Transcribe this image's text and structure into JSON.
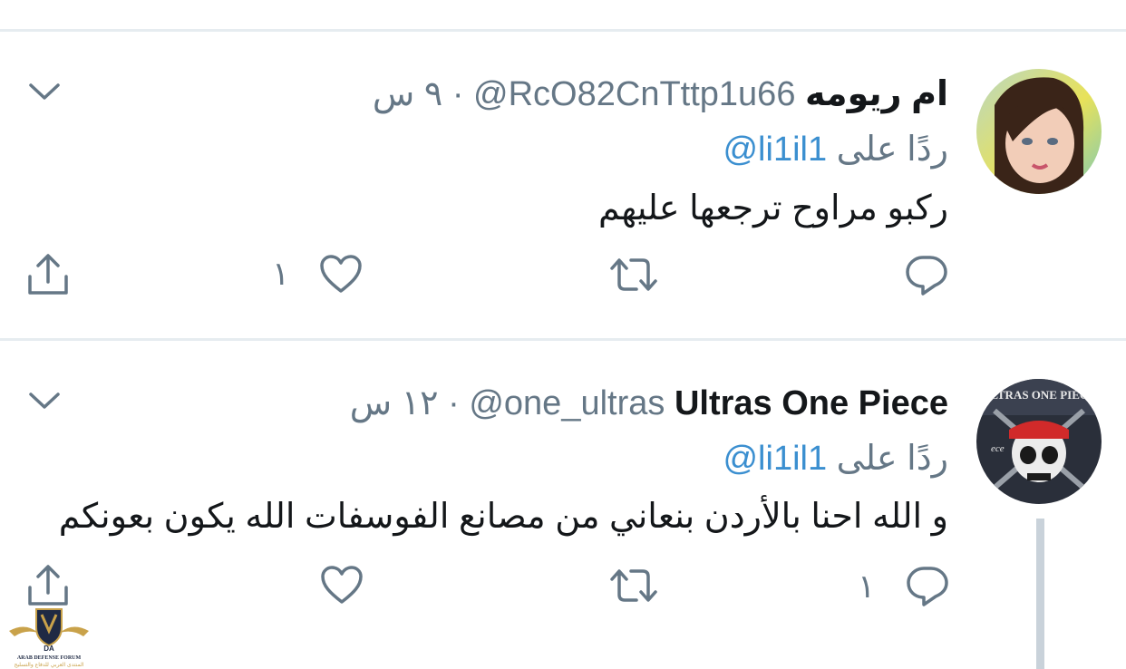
{
  "tweets": [
    {
      "name": "ام ريومه",
      "handle": "@RcO82CnTttp1u66",
      "separator": "·",
      "time": "٩ س",
      "replying_prefix": "ردًا على",
      "replying_to": "@li1il1",
      "text": "ركبو مراوح ترجعها عليهم",
      "reply_count": "",
      "like_count": "١",
      "avatar_icon": "avatar-photo-girl"
    },
    {
      "name": "Ultras One Piece",
      "handle": "@one_ultras",
      "separator": "·",
      "time": "١٢ س",
      "replying_prefix": "ردًا على",
      "replying_to": "@li1il1",
      "text": "و الله احنا بالأردن بنعاني من مصانع الفوسفات الله يكون بعونكم",
      "reply_count": "١",
      "like_count": "",
      "avatar_icon": "avatar-skull-pirate"
    }
  ],
  "watermark": {
    "line1": "ARAB DEFENSE FORUM",
    "line2": "المنتدى العربي للدفاع والتسليح",
    "monogram": "DA"
  },
  "colors": {
    "text": "#14171a",
    "muted": "#657786",
    "link": "#3b8fd0",
    "divider": "#e6ecf0",
    "icon": "#657786"
  }
}
